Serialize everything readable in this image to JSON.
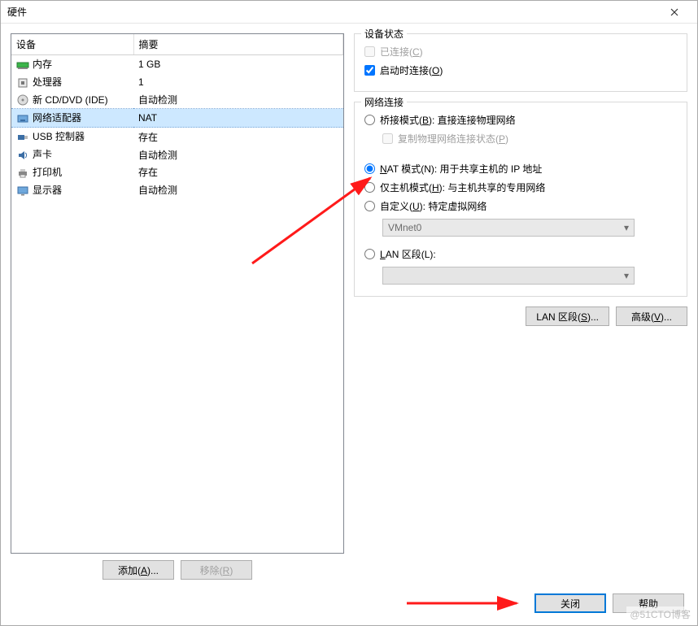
{
  "title": "硬件",
  "columns": {
    "device": "设备",
    "summary": "摘要"
  },
  "hardware": [
    {
      "icon": "memory-icon",
      "name": "内存",
      "summary": "1 GB",
      "selected": false
    },
    {
      "icon": "cpu-icon",
      "name": "处理器",
      "summary": "1",
      "selected": false
    },
    {
      "icon": "cd-icon",
      "name": "新 CD/DVD (IDE)",
      "summary": "自动检测",
      "selected": false
    },
    {
      "icon": "nic-icon",
      "name": "网络适配器",
      "summary": "NAT",
      "selected": true
    },
    {
      "icon": "usb-icon",
      "name": "USB 控制器",
      "summary": "存在",
      "selected": false
    },
    {
      "icon": "sound-icon",
      "name": "声卡",
      "summary": "自动检测",
      "selected": false
    },
    {
      "icon": "printer-icon",
      "name": "打印机",
      "summary": "存在",
      "selected": false
    },
    {
      "icon": "display-icon",
      "name": "显示器",
      "summary": "自动检测",
      "selected": false
    }
  ],
  "buttons": {
    "add": "添加(A)...",
    "remove": "移除(R)",
    "lan_segments": "LAN 区段(S)...",
    "advanced": "高级(V)...",
    "close": "关闭",
    "help": "帮助"
  },
  "device_state": {
    "legend": "设备状态",
    "connected": "已连接(C)",
    "connect_on_poweron": "启动时连接(O)"
  },
  "net_conn": {
    "legend": "网络连接",
    "bridged": "桥接模式(B): 直接连接物理网络",
    "bridged_copy": "复制物理网络连接状态(P)",
    "nat": "NAT 模式(N): 用于共享主机的 IP 地址",
    "hostonly": "仅主机模式(H): 与主机共享的专用网络",
    "custom": "自定义(U): 特定虚拟网络",
    "custom_value": "VMnet0",
    "lan": "LAN 区段(L):",
    "lan_value": ""
  },
  "watermark": "@51CTO博客"
}
